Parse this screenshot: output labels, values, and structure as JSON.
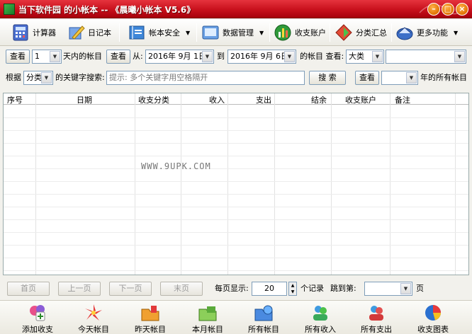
{
  "window": {
    "title": "当下软件园 的小帐本 -- 《晨曦小帐本 V5.6》"
  },
  "toolbar": {
    "items": [
      {
        "label": "计算器",
        "icon": "calculator-icon"
      },
      {
        "label": "日记本",
        "icon": "diary-pen-icon"
      },
      {
        "label": "帐本安全",
        "icon": "ledger-security-icon"
      },
      {
        "label": "数据管理",
        "icon": "data-manage-icon"
      },
      {
        "label": "收支账户",
        "icon": "account-chart-icon"
      },
      {
        "label": "分类汇总",
        "icon": "category-summary-icon"
      },
      {
        "label": "更多功能",
        "icon": "more-functions-icon"
      }
    ]
  },
  "filter": {
    "view_button": "查看",
    "days_value": "1",
    "days_suffix": "天内的帐目",
    "view_button2": "查看",
    "from_label": "从:",
    "from_date": "2016年 9月 1日",
    "to_label": "到",
    "to_date": "2016年 9月 6日",
    "of_label": "的帐目 查看:",
    "category_select": "大类",
    "subcategory_select": ""
  },
  "search": {
    "by_label": "根据",
    "field_select": "分类",
    "keyword_label": "的关键字搜索:",
    "placeholder": "提示: 多个关键字用空格隔开",
    "search_button": "搜 索",
    "view_button": "查看",
    "year_select": "",
    "year_suffix": "年的所有帐目"
  },
  "table": {
    "columns": [
      "序号",
      "日期",
      "收支分类",
      "收入",
      "支出",
      "结余",
      "收支账户",
      "备注"
    ],
    "rows": [],
    "watermark": "WWW.9UPK.COM"
  },
  "pager": {
    "first": "首页",
    "prev": "上一页",
    "next": "下一页",
    "last": "末页",
    "per_page_label": "每页显示:",
    "per_page_value": "20",
    "records_label": "个记录",
    "jump_label": "跳到第:",
    "jump_value": "",
    "page_label": "页"
  },
  "bottom": {
    "items": [
      {
        "label": "添加收支",
        "icon": "add-entry-icon"
      },
      {
        "label": "今天帐目",
        "icon": "today-icon"
      },
      {
        "label": "昨天帐目",
        "icon": "yesterday-icon"
      },
      {
        "label": "本月帐目",
        "icon": "month-icon"
      },
      {
        "label": "所有帐目",
        "icon": "all-entries-icon"
      },
      {
        "label": "所有收入",
        "icon": "all-income-icon"
      },
      {
        "label": "所有支出",
        "icon": "all-expense-icon"
      },
      {
        "label": "收支图表",
        "icon": "pie-chart-icon"
      }
    ]
  },
  "colors": {
    "titlebar": "#c8101c",
    "window_bg": "#f2f1ec",
    "grid_bg": "#ffffff"
  }
}
